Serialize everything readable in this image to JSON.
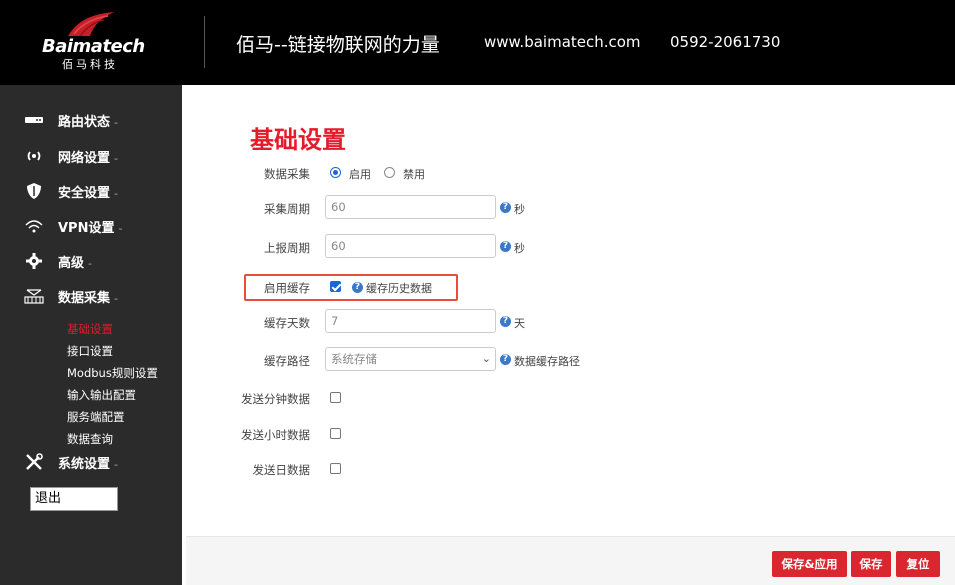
{
  "header": {
    "logo_text": "Baimatech",
    "logo_sub": "佰马科技",
    "slogan": "佰马--链接物联网的力量",
    "website": "www.baimatech.com",
    "phone": "0592-2061730"
  },
  "sidebar": {
    "items": [
      {
        "label": "路由状态",
        "icon": "status-icon"
      },
      {
        "label": "网络设置",
        "icon": "signal-icon"
      },
      {
        "label": "安全设置",
        "icon": "shield-icon"
      },
      {
        "label": "VPN设置",
        "icon": "wifi-icon"
      },
      {
        "label": "高级",
        "icon": "gear-icon"
      },
      {
        "label": "数据采集",
        "icon": "network-icon"
      },
      {
        "label": "系统设置",
        "icon": "tools-icon"
      }
    ],
    "caret": "-",
    "subitems": [
      "基础设置",
      "接口设置",
      "Modbus规则设置",
      "输入输出配置",
      "服务端配置",
      "数据查询"
    ],
    "active_subitem": "基础设置",
    "logout_label": "退出"
  },
  "page": {
    "title": "基础设置"
  },
  "form": {
    "data_collect": {
      "label": "数据采集",
      "options": [
        "启用",
        "禁用"
      ],
      "selected": "启用"
    },
    "collect_period": {
      "label": "采集周期",
      "value": "60",
      "unit": "秒"
    },
    "report_period": {
      "label": "上报周期",
      "value": "60",
      "unit": "秒"
    },
    "enable_cache": {
      "label": "启用缓存",
      "checked": true,
      "help": "缓存历史数据"
    },
    "cache_days": {
      "label": "缓存天数",
      "value": "7",
      "unit": "天"
    },
    "cache_path": {
      "label": "缓存路径",
      "value": "系统存储",
      "help": "数据缓存路径"
    },
    "send_minute": {
      "label": "发送分钟数据",
      "checked": false
    },
    "send_hour": {
      "label": "发送小时数据",
      "checked": false
    },
    "send_day": {
      "label": "发送日数据",
      "checked": false
    }
  },
  "buttons": {
    "save_apply": "保存&应用",
    "save": "保存",
    "reset": "复位"
  },
  "colors": {
    "accent": "#e51a2a",
    "sidebar_bg": "#2b2b2b",
    "header_bg": "#000000",
    "checkbox_blue": "#1a66d6",
    "help_blue": "#3a78c8",
    "highlight": "#e74c3c"
  },
  "help_icon_glyph": "?"
}
